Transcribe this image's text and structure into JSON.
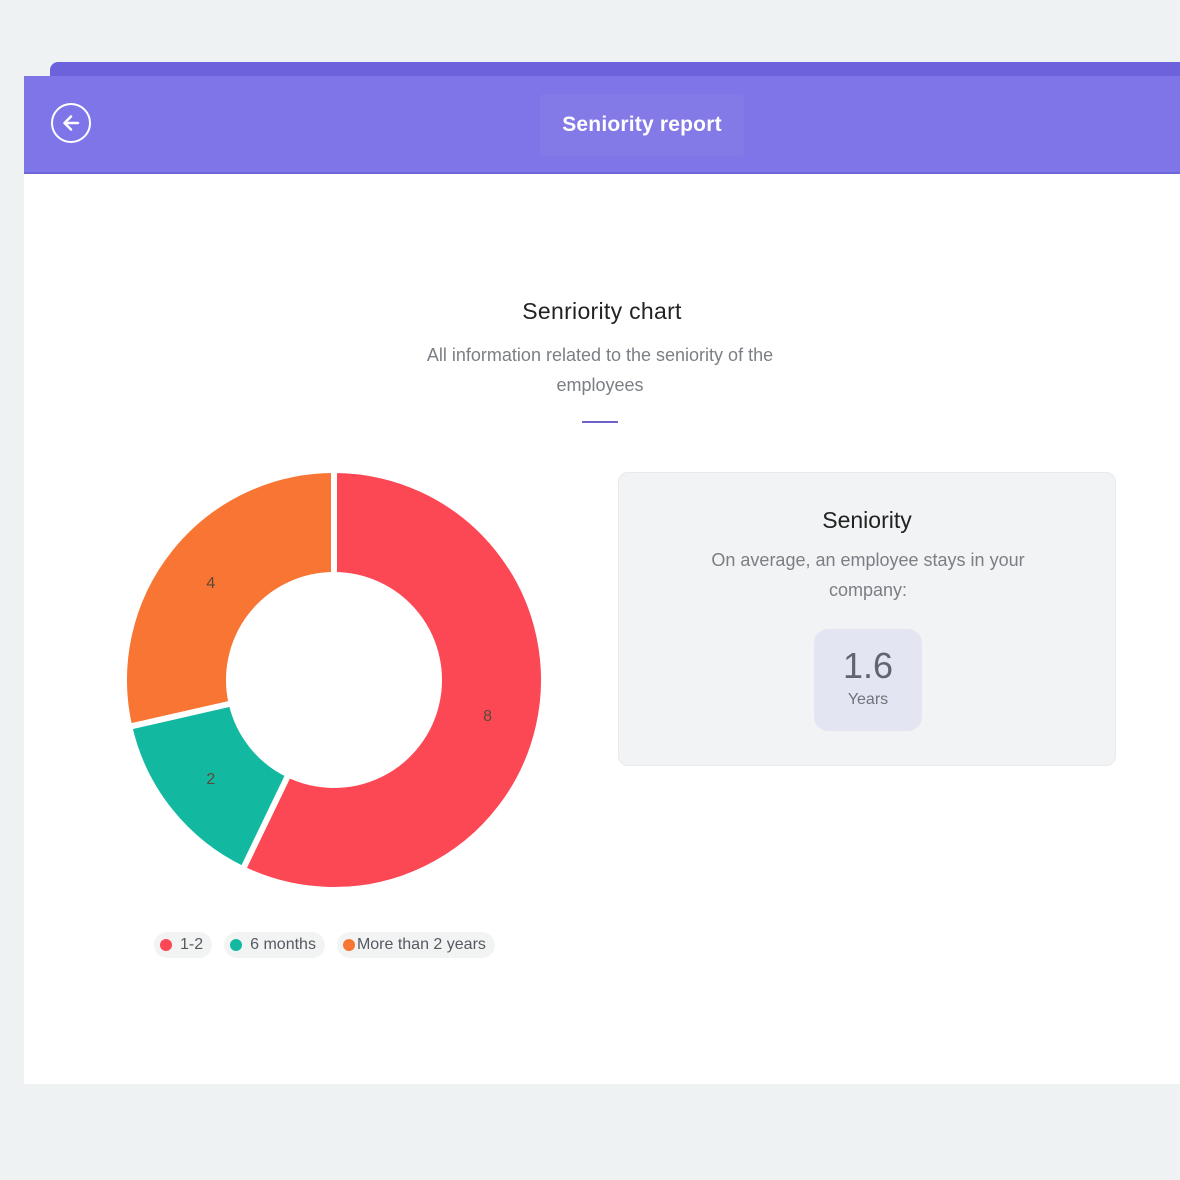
{
  "header": {
    "title": "Seniority report",
    "back_icon": "arrow-left-circle-icon"
  },
  "chart_section": {
    "title": "Senriority chart",
    "subtitle": "All information related to the seniority of the employees"
  },
  "chart_data": {
    "type": "pie",
    "donut": true,
    "categories": [
      "1-2",
      "6 months",
      "More than 2 years"
    ],
    "values": [
      8,
      2,
      4
    ],
    "colors": [
      "#fc4854",
      "#12b9a0",
      "#f97533"
    ],
    "legend_position": "bottom"
  },
  "stat": {
    "title": "Seniority",
    "description": "On average, an employee stays in your company:",
    "value": "1.6",
    "unit": "Years"
  }
}
